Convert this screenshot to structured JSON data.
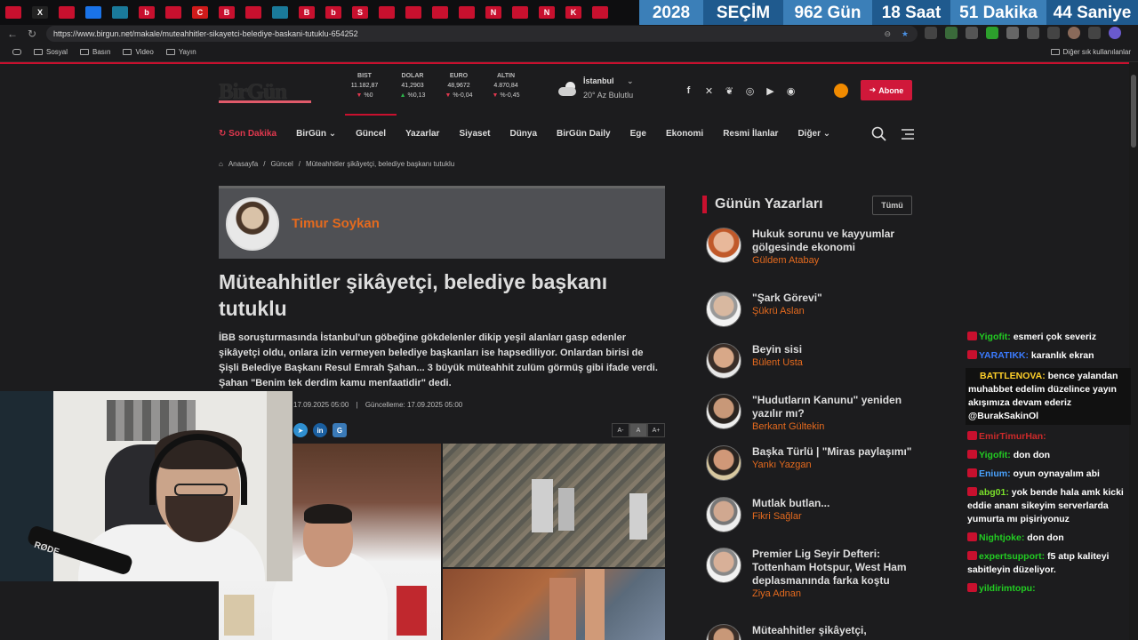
{
  "browser": {
    "url": "https://www.birgun.net/makale/muteahhitler-sikayetci-belediye-baskani-tutuklu-654252",
    "tab_letters": [
      "",
      "X",
      "",
      "",
      "",
      "b",
      "",
      "C",
      "B",
      "",
      "",
      "B",
      "b",
      "S",
      "",
      "",
      "",
      "",
      "N",
      "",
      "N",
      "K",
      ""
    ],
    "bookmarks": [
      "Sosyal",
      "Basın",
      "Video",
      "Yayın"
    ],
    "bookmarks_other": "Diğer sık kullanılanlar"
  },
  "countdown": {
    "year": "2028",
    "label": "SEÇİM",
    "days": "962 Gün",
    "hours": "18 Saat",
    "minutes": "51 Dakika",
    "seconds": "44 Saniye"
  },
  "site": {
    "logo": "BirGün",
    "markets": [
      {
        "name": "BIST",
        "value": "11.182,87",
        "change": "%0",
        "direction": "down"
      },
      {
        "name": "DOLAR",
        "value": "41,2903",
        "change": "%0,13",
        "direction": "up"
      },
      {
        "name": "EURO",
        "value": "48,9672",
        "change": "%-0,04",
        "direction": "down"
      },
      {
        "name": "ALTIN",
        "value": "4.870,84",
        "change": "%-0,45",
        "direction": "down"
      }
    ],
    "weather": {
      "city": "İstanbul",
      "desc": "20° Az Bulutlu"
    },
    "social_icons": [
      "facebook-icon",
      "x-icon",
      "bluesky-icon",
      "instagram-icon",
      "youtube-icon",
      "rss-icon"
    ],
    "subscribe": "Abone",
    "nav": [
      "Son Dakika",
      "BirGün",
      "Güncel",
      "Yazarlar",
      "Siyaset",
      "Dünya",
      "BirGün Daily",
      "Ege",
      "Ekonomi",
      "Resmi İlanlar",
      "Diğer"
    ],
    "breadcrumb": [
      "Anasayfa",
      "Güncel",
      "Müteahhitler şikâyetçi, belediye başkanı tutuklu"
    ]
  },
  "article": {
    "author": "Timur Soykan",
    "headline": "Müteahhitler şikâyetçi, belediye başkanı tutuklu",
    "lead": "İBB soruşturmasında İstanbul'un göbeğine gökdelenler dikip yeşil alanları gasp edenler şikâyetçi oldu, onlara izin vermeyen belediye başkanları ise hapsediliyor. Onlardan birisi de Şişli Belediye Başkanı Resul Emrah Şahan... 3 büyük müteahhit zulüm görmüş gibi ifade verdi. Şahan \"Benim tek derdim kamu menfaatidir\" dedi.",
    "published": "17.09.2025 05:00",
    "updated": "Güncelleme: 17.09.2025 05:00",
    "font_buttons": [
      "A-",
      "A",
      "A+"
    ]
  },
  "sidebar": {
    "title": "Günün Yazarları",
    "all_button": "Tümü",
    "writers": [
      {
        "title": "Hukuk sorunu ve kayyumlar gölgesinde ekonomi",
        "name": "Güldem Atabay"
      },
      {
        "title": "\"Şark Görevi\"",
        "name": "Şükrü Aslan"
      },
      {
        "title": "Beyin sisi",
        "name": "Bülent Usta"
      },
      {
        "title": "\"Hudutların Kanunu\" yeniden yazılır mı?",
        "name": "Berkant Gültekin"
      },
      {
        "title": "Başka Türlü | \"Miras paylaşımı\"",
        "name": "Yankı Yazgan"
      },
      {
        "title": "Mutlak butlan...",
        "name": "Fikri Sağlar"
      },
      {
        "title": "Premier Lig Seyir Defteri: Tottenham Hotspur, West Ham deplasmanında farka koştu",
        "name": "Ziya Adnan"
      },
      {
        "title": "Müteahhitler şikâyetçi,",
        "name": ""
      }
    ]
  },
  "webcam": {
    "mic_label": "RØDE"
  },
  "chat": [
    {
      "user": "Yigofit",
      "text": "esmeri çok severiz",
      "color": "#22cc22"
    },
    {
      "user": "YARATIKK",
      "text": "karanlık ekran",
      "color": "#3b7bff"
    },
    {
      "user": "BATTLENOVA",
      "text": "bence yalandan muhabbet edelim düzelince yayın akışımıza devam ederiz @BurakSakinOl",
      "color": "#ffd02a",
      "highlight": true
    },
    {
      "user": "EmirTimurHan",
      "text": "",
      "color": "#cc2a2a"
    },
    {
      "user": "Yigofit",
      "text": "don don",
      "color": "#22cc22"
    },
    {
      "user": "Enium",
      "text": "oyun oynayalım abi",
      "color": "#4aa3ff"
    },
    {
      "user": "abg01",
      "text": "yok bende hala amk kicki eddie ananı sikeyim serverlarda yumurta mı pişiriyonuz",
      "color": "#7adf2a"
    },
    {
      "user": "Nightjoke",
      "text": "don don",
      "color": "#22cc22"
    },
    {
      "user": "expertsupport",
      "text": "f5 atıp kaliteyi sabitleyin düzeliyor.",
      "color": "#22cc22"
    },
    {
      "user": "yildirimtopu",
      "text": "",
      "color": "#22cc22"
    }
  ]
}
